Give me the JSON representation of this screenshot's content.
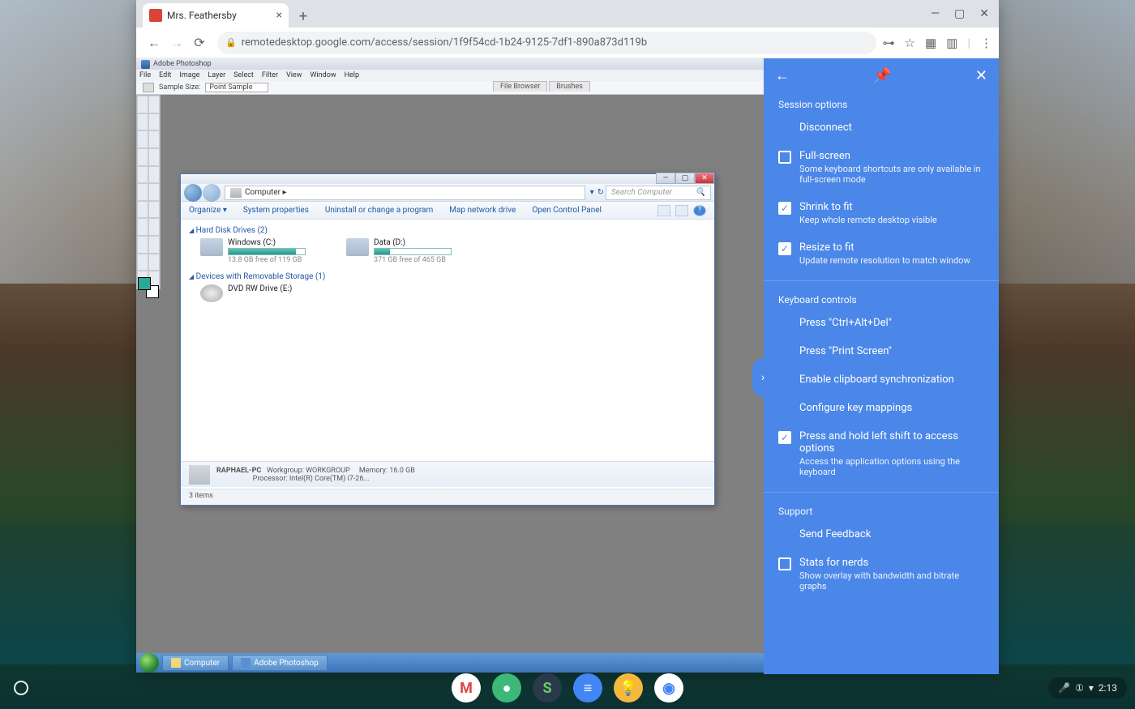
{
  "tab": {
    "title": "Mrs. Feathersby"
  },
  "url": "remotedesktop.google.com/access/session/1f9f54cd-1b24-9125-7df1-890a873d119b",
  "rd_panel": {
    "sections": {
      "session": "Session options",
      "keyboard": "Keyboard controls",
      "support": "Support"
    },
    "disconnect": "Disconnect",
    "fullscreen": {
      "title": "Full-screen",
      "desc": "Some keyboard shortcuts are only available in full-screen mode",
      "checked": false
    },
    "shrink": {
      "title": "Shrink to fit",
      "desc": "Keep whole remote desktop visible",
      "checked": true
    },
    "resize": {
      "title": "Resize to fit",
      "desc": "Update remote resolution to match window",
      "checked": true
    },
    "cad": "Press \"Ctrl+Alt+Del\"",
    "prtsc": "Press \"Print Screen\"",
    "clipboard": "Enable clipboard synchronization",
    "keymap": "Configure key mappings",
    "leftshift": {
      "title": "Press and hold left shift to access options",
      "desc": "Access the application options using the keyboard",
      "checked": true
    },
    "feedback": "Send Feedback",
    "stats": {
      "title": "Stats for nerds",
      "desc": "Show overlay with bandwidth and bitrate graphs",
      "checked": false
    }
  },
  "photoshop": {
    "title": "Adobe Photoshop",
    "menus": [
      "File",
      "Edit",
      "Image",
      "Layer",
      "Select",
      "Filter",
      "View",
      "Window",
      "Help"
    ],
    "opt_label": "Sample Size:",
    "opt_value": "Point Sample",
    "tabs": [
      "File Browser",
      "Brushes"
    ]
  },
  "explorer": {
    "path": "Computer ▸",
    "search_ph": "Search Computer",
    "toolbar": [
      "Organize ▾",
      "System properties",
      "Uninstall or change a program",
      "Map network drive",
      "Open Control Panel"
    ],
    "group1": "Hard Disk Drives (2)",
    "drives": [
      {
        "name": "Windows (C:)",
        "sub": "13.8 GB free of 119 GB",
        "fill": 88
      },
      {
        "name": "Data (D:)",
        "sub": "371 GB free of 465 GB",
        "fill": 20
      }
    ],
    "group2": "Devices with Removable Storage (1)",
    "dvd": "DVD RW Drive (E:)",
    "status": {
      "name": "RAPHAEL-PC",
      "wg_l": "Workgroup:",
      "wg_v": "WORKGROUP",
      "proc_l": "Processor:",
      "proc_v": "Intel(R) Core(TM) i7-26...",
      "mem_l": "Memory:",
      "mem_v": "16.0 GB"
    },
    "items": "3 items"
  },
  "taskbar": {
    "items": [
      "Computer",
      "Adobe Photoshop"
    ]
  },
  "shelf": {
    "apps": [
      {
        "bg": "#ffffff",
        "letter": "M",
        "color": "#d44"
      },
      {
        "bg": "#3cb878",
        "letter": "●",
        "color": "#fff"
      },
      {
        "bg": "#2a3a4a",
        "letter": "S",
        "color": "#6c6"
      },
      {
        "bg": "#4285f4",
        "letter": "≡",
        "color": "#fff"
      },
      {
        "bg": "#f6b83c",
        "letter": "💡",
        "color": "#fff"
      },
      {
        "bg": "#ffffff",
        "letter": "◉",
        "color": "#4285f4"
      }
    ],
    "time": "2:13"
  }
}
